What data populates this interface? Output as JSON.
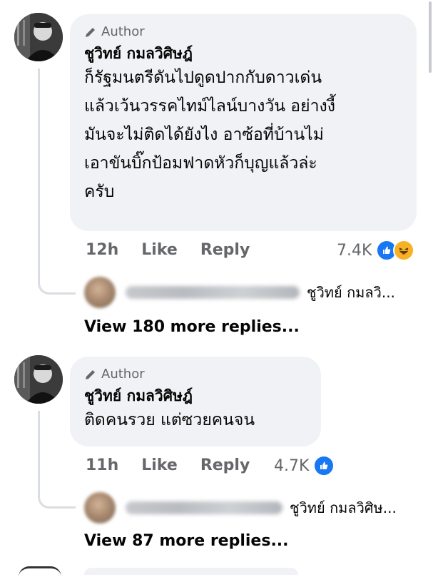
{
  "comments": [
    {
      "author_tag": "Author",
      "name": "ชูวิทย์ กมลวิศิษฎ์",
      "text": "ก็รัฐมนตรีดันไปดูดปากกับดาวเด่น\nแล้วเว้นวรรคไทม์ไลน์บางวัน อย่างงี้\nมันจะไม่ติดได้ยังไง อาซ้อที่บ้านไม่\nเอาขันบิ๊กป้อมฟาดหัวก็บุญแล้วล่ะ\nครับ",
      "time": "12h",
      "like_label": "Like",
      "reply_label": "Reply",
      "reaction_count": "7.4K",
      "reactions": [
        "like-icon",
        "haha-icon"
      ],
      "reply_preview_snippet": "ชูวิทย์ กมลวิ...",
      "view_more": "View 180 more replies..."
    },
    {
      "author_tag": "Author",
      "name": "ชูวิทย์ กมลวิศิษฎ์",
      "text": "ติดคนรวย แต่ซวยคนจน",
      "time": "11h",
      "like_label": "Like",
      "reply_label": "Reply",
      "reaction_count": "4.7K",
      "reactions": [
        "like-icon"
      ],
      "reply_preview_snippet": "ชูวิทย์ กมลวิศิษ...",
      "view_more": "View 87 more replies..."
    }
  ],
  "colors": {
    "bubble": "#f0f2f5",
    "meta_text": "#65676b",
    "like_blue": "#1877f2",
    "haha_yellow": "#f7b125"
  }
}
